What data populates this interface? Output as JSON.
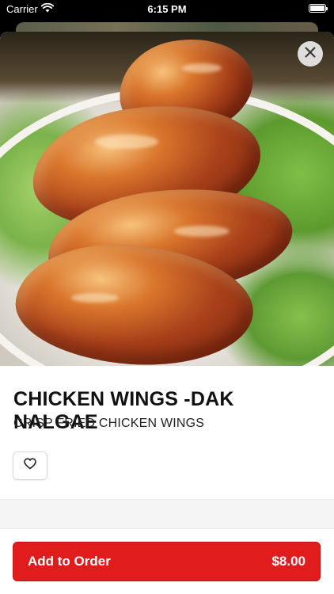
{
  "status_bar": {
    "carrier": "Carrier",
    "time": "6:15 PM",
    "icons": [
      "wifi-icon",
      "battery-icon"
    ]
  },
  "item": {
    "name": "CHICKEN WINGS -DAK NALGAE",
    "description": "CRISP FRIED CHICKEN WINGS",
    "photo_alt": "chicken-wings-photo"
  },
  "actions": {
    "close_icon": "close-icon",
    "favorite_icon": "heart-icon",
    "add_to_order_label": "Add to Order",
    "price": "$8.00"
  },
  "colors": {
    "accent": "#e01c1c",
    "text": "#111111"
  }
}
